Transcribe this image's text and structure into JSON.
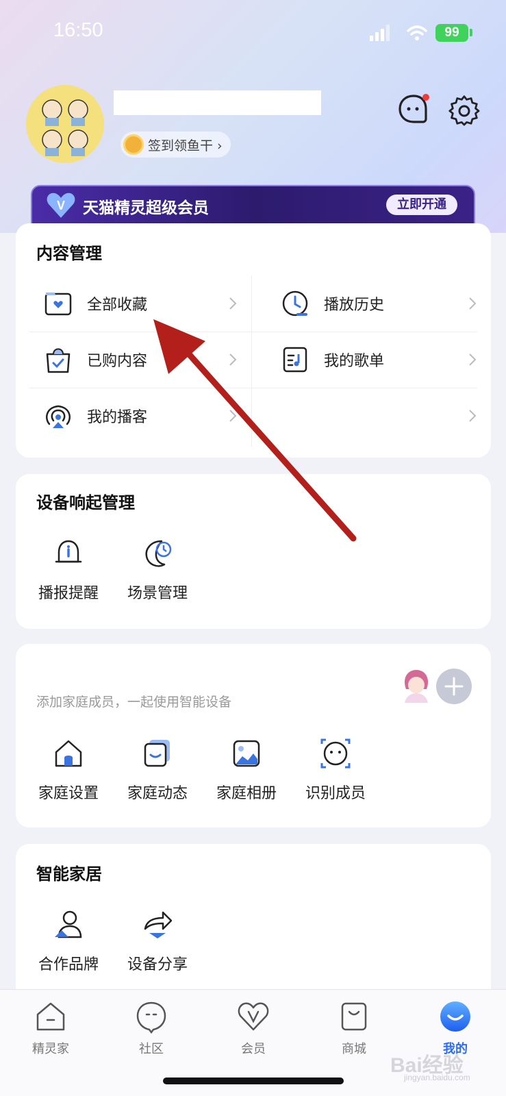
{
  "status": {
    "time": "16:50",
    "battery": "99"
  },
  "profile": {
    "signin_label": "签到领鱼干 ›"
  },
  "vip": {
    "title": "天猫精灵超级会员",
    "button": "立即开通"
  },
  "content": {
    "title": "内容管理",
    "items": [
      {
        "label": "全部收藏",
        "icon": "folder-heart-icon"
      },
      {
        "label": "播放历史",
        "icon": "clock-icon"
      },
      {
        "label": "已购内容",
        "icon": "shopping-bag-icon"
      },
      {
        "label": "我的歌单",
        "icon": "music-list-icon"
      },
      {
        "label": "我的播客",
        "icon": "podcast-icon"
      },
      {
        "label": "",
        "icon": ""
      }
    ]
  },
  "device": {
    "title": "设备响起管理",
    "items": [
      {
        "label": "播报提醒",
        "icon": "bell-icon"
      },
      {
        "label": "场景管理",
        "icon": "moon-clock-icon"
      }
    ]
  },
  "family": {
    "hint": "添加家庭成员，一起使用智能设备",
    "items": [
      {
        "label": "家庭设置",
        "icon": "house-icon"
      },
      {
        "label": "家庭动态",
        "icon": "family-feed-icon"
      },
      {
        "label": "家庭相册",
        "icon": "photo-album-icon"
      },
      {
        "label": "识别成员",
        "icon": "face-scan-icon"
      }
    ]
  },
  "smarthome": {
    "title": "智能家居",
    "items": [
      {
        "label": "合作品牌",
        "icon": "partner-brand-icon"
      },
      {
        "label": "设备分享",
        "icon": "share-device-icon"
      }
    ]
  },
  "tabs": [
    {
      "label": "精灵家",
      "icon": "home-tab-icon"
    },
    {
      "label": "社区",
      "icon": "community-tab-icon"
    },
    {
      "label": "会员",
      "icon": "vip-tab-icon"
    },
    {
      "label": "商城",
      "icon": "shop-tab-icon"
    },
    {
      "label": "我的",
      "icon": "me-tab-icon",
      "active": true
    }
  ],
  "watermark": {
    "text": "Bai经验",
    "sub": "jingyan.baidu.com"
  },
  "colors": {
    "accent": "#2b6cf5",
    "vip_bg": "#2d1b6e",
    "arrow": "#b3201c"
  }
}
